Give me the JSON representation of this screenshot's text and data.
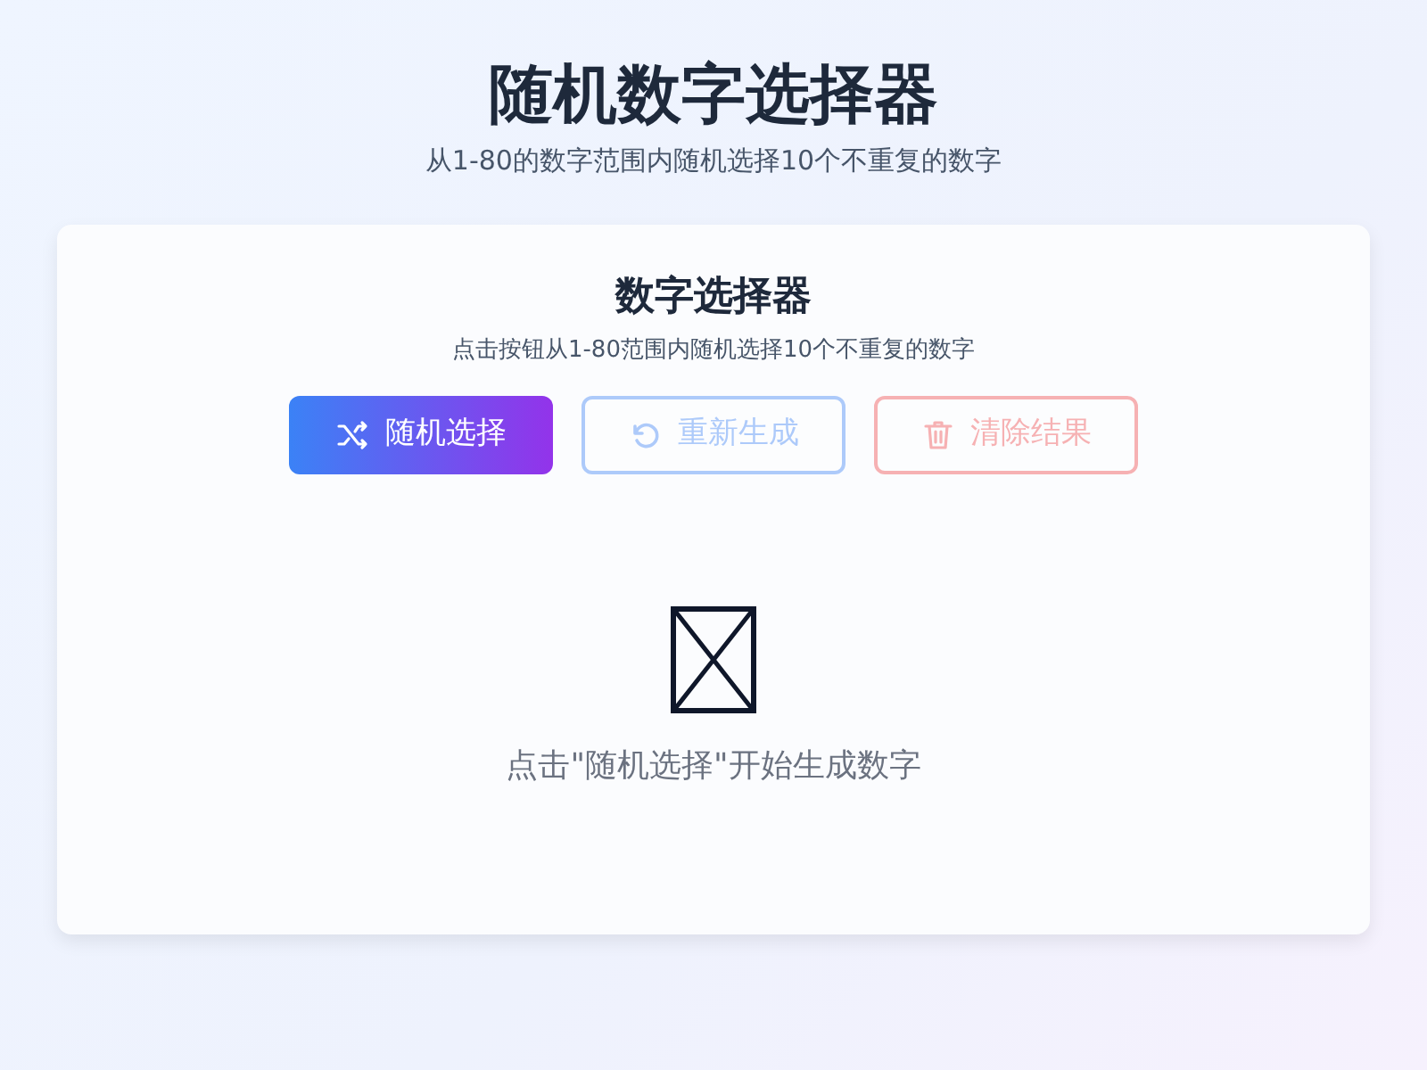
{
  "header": {
    "title": "随机数字选择器",
    "subtitle": "从1-80的数字范围内随机选择10个不重复的数字"
  },
  "card": {
    "title": "数字选择器",
    "description": "点击按钮从1-80范围内随机选择10个不重复的数字",
    "buttons": [
      {
        "kind": "shuffle",
        "label": "随机选择",
        "disabled": false
      },
      {
        "kind": "regenerate",
        "label": "重新生成",
        "disabled": true
      },
      {
        "kind": "clear",
        "label": "清除结果",
        "disabled": true
      }
    ],
    "empty_state": {
      "message": "点击\"随机选择\"开始生成数字"
    }
  }
}
